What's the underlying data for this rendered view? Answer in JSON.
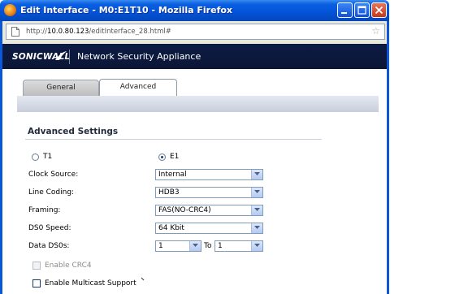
{
  "window": {
    "title": "Edit Interface - M0:E1T10 - Mozilla Firefox"
  },
  "address": {
    "url_prefix": "http://",
    "url_host": "10.0.80.123",
    "url_path": "/editInterface_28.html#"
  },
  "banner": {
    "logo": "SONICWALL",
    "product": "Network Security Appliance"
  },
  "tabs": [
    {
      "label": "General",
      "active": false
    },
    {
      "label": "Advanced",
      "active": true
    }
  ],
  "section": {
    "title": "Advanced Settings"
  },
  "line_type": {
    "t1_label": "T1",
    "e1_label": "E1",
    "selected": "E1"
  },
  "fields": {
    "clock_source": {
      "label": "Clock Source:",
      "value": "Internal"
    },
    "line_coding": {
      "label": "Line Coding:",
      "value": "HDB3"
    },
    "framing": {
      "label": "Framing:",
      "value": "FAS(NO-CRC4)"
    },
    "ds0_speed": {
      "label": "DS0 Speed:",
      "value": "64 Kbit"
    },
    "data_ds0s": {
      "label": "Data DS0s:",
      "from": "1",
      "to_label": "To",
      "to": "1"
    }
  },
  "options": {
    "enable_crc4": {
      "label": "Enable CRC4",
      "checked": false,
      "disabled": true
    },
    "enable_multicast": {
      "label": "Enable Multicast Support",
      "checked": false,
      "disabled": false
    }
  },
  "colors": {
    "titlebar": "#0353d8",
    "banner": "#0b1636",
    "frame": "#0a58d8"
  }
}
